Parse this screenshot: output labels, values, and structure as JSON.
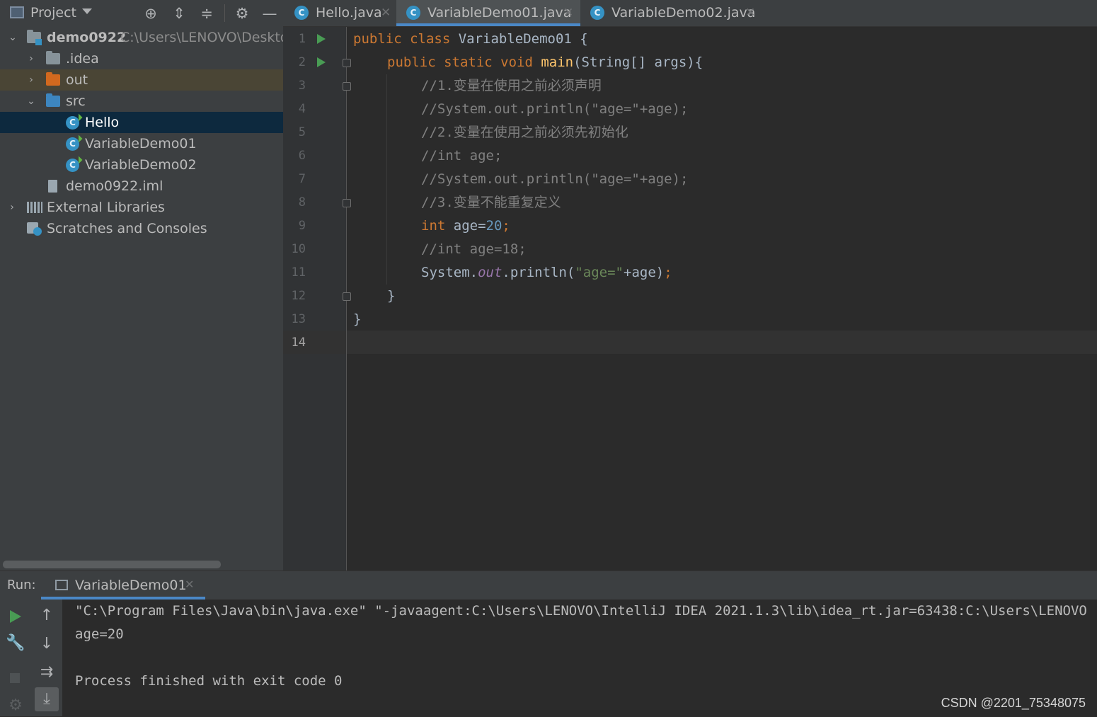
{
  "project_panel": {
    "title": "Project",
    "tree": {
      "root": {
        "name": "demo0922",
        "path": "C:\\Users\\LENOVO\\Desktop"
      },
      "idea": ".idea",
      "out": "out",
      "src": "src",
      "files": [
        "Hello",
        "VariableDemo01",
        "VariableDemo02"
      ],
      "iml": "demo0922.iml",
      "external_libraries": "External Libraries",
      "scratches": "Scratches and Consoles"
    }
  },
  "tabs": [
    {
      "label": "Hello.java",
      "active": false
    },
    {
      "label": "VariableDemo01.java",
      "active": true
    },
    {
      "label": "VariableDemo02.java",
      "active": false
    }
  ],
  "editor": {
    "line_numbers": [
      "1",
      "2",
      "3",
      "4",
      "5",
      "6",
      "7",
      "8",
      "9",
      "10",
      "11",
      "12",
      "13",
      "14"
    ],
    "current_line": "14",
    "code": {
      "l1_kw": "public class ",
      "l1_rest": "VariableDemo01 {",
      "l2_kw": "public static void ",
      "l2_fn": "main",
      "l2_rest": "(String[] args){",
      "l3": "//1.变量在使用之前必须声明",
      "l4": "//System.out.println(\"age=\"+age);",
      "l5": "//2.变量在使用之前必须先初始化",
      "l6": "//int age;",
      "l7": "//System.out.println(\"age=\"+age);",
      "l8": "//3.变量不能重复定义",
      "l9_kw": "int",
      "l9_mid": " age=",
      "l9_num": "20",
      "l9_end": ";",
      "l10": "//int age=18;",
      "l11_a": "System.",
      "l11_fld": "out",
      "l11_b": ".println(",
      "l11_str": "\"age=\"",
      "l11_c": "+age)",
      "l11_end": ";",
      "l12": "}",
      "l13": "}"
    }
  },
  "run": {
    "label": "Run:",
    "tab": "VariableDemo01",
    "output": [
      "\"C:\\Program Files\\Java\\bin\\java.exe\" \"-javaagent:C:\\Users\\LENOVO\\IntelliJ IDEA 2021.1.3\\lib\\idea_rt.jar=63438:C:\\Users\\LENOVO",
      "age=20",
      "",
      "Process finished with exit code 0"
    ]
  },
  "watermark": "CSDN @2201_75348075",
  "colors": {
    "keyword": "#cc7832",
    "method": "#ffc66d",
    "comment": "#808080",
    "number": "#6897bb",
    "string": "#6a8759",
    "selection": "#0d293e",
    "accent": "#4a88c7",
    "run_green": "#499c54"
  }
}
